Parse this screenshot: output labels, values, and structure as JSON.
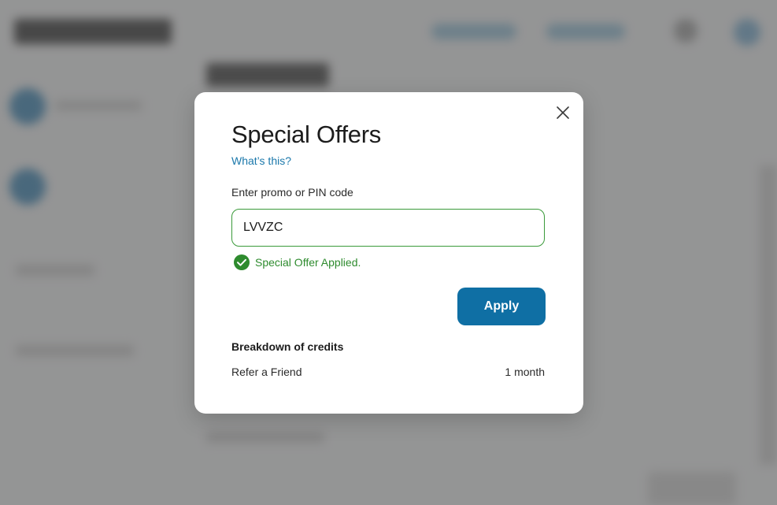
{
  "modal": {
    "title": "Special Offers",
    "help_link": "What’s this?",
    "field_label": "Enter promo or PIN code",
    "promo_value": "LVVZC",
    "status_message": "Special Offer Applied.",
    "apply_label": "Apply",
    "breakdown_title": "Breakdown of credits",
    "credits": [
      {
        "name": "Refer a Friend",
        "value": "1 month"
      }
    ],
    "icons": {
      "close": "close-icon",
      "success": "check-circle-icon"
    }
  },
  "colors": {
    "accent": "#0f6fa4",
    "link": "#1b78ab",
    "success": "#2e8b2e",
    "overlay": "rgba(90,90,90,0.62)"
  }
}
